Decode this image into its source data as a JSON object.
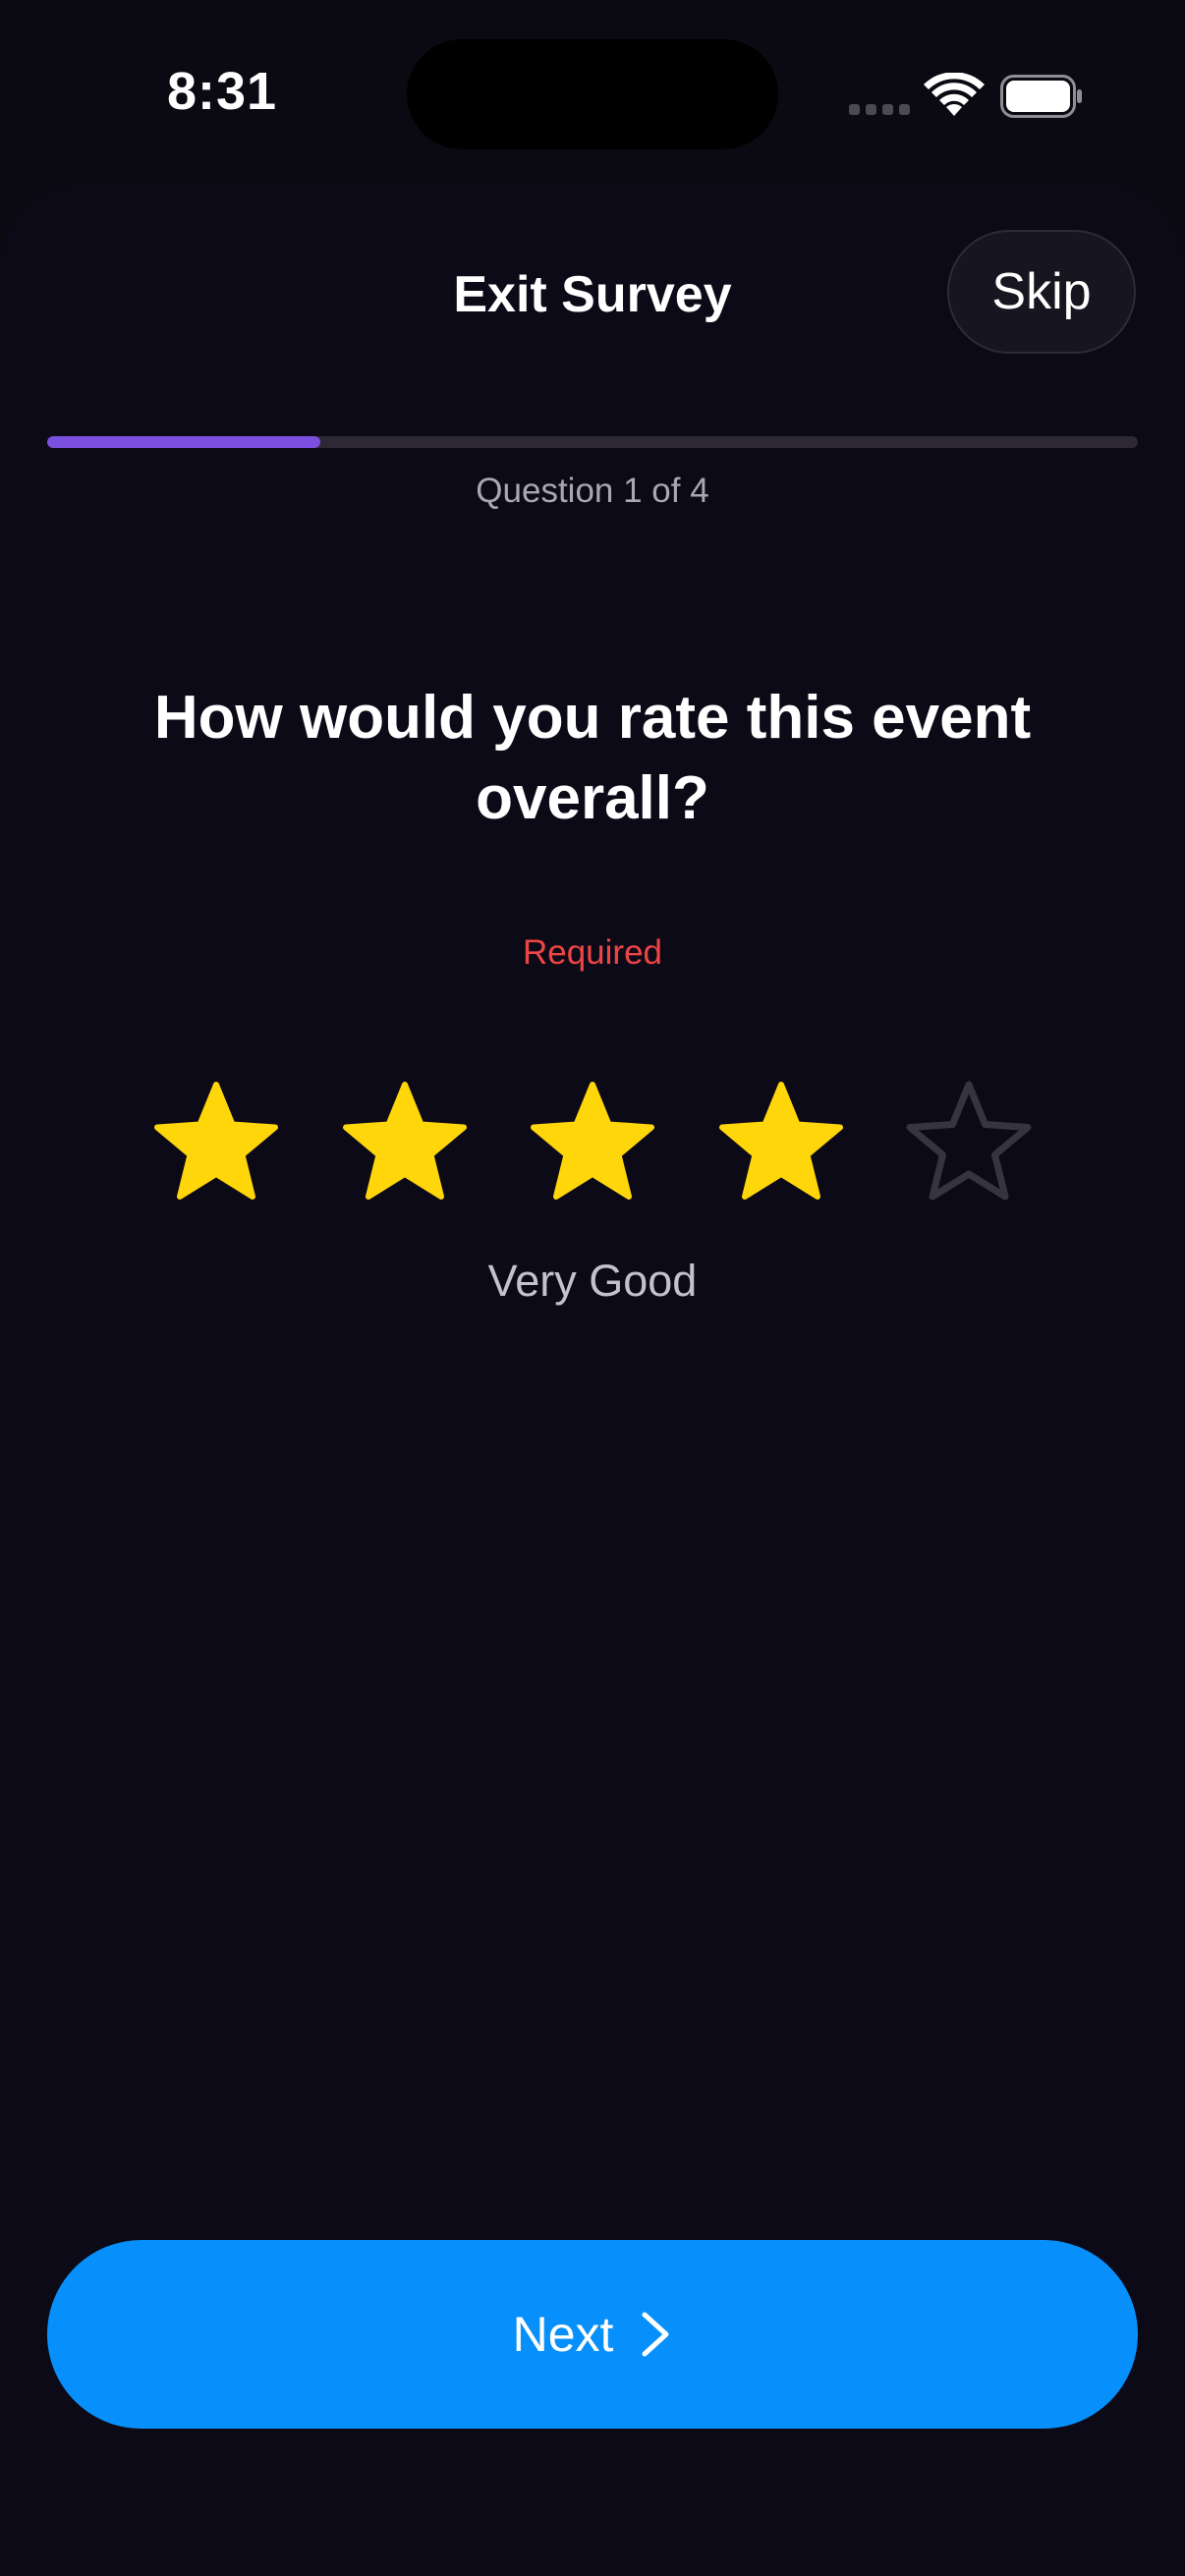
{
  "status_bar": {
    "time": "8:31"
  },
  "survey": {
    "title": "Exit Survey",
    "skip_label": "Skip",
    "progress": {
      "label": "Question 1 of 4",
      "fraction": 0.25,
      "color": "#7b4fe0"
    },
    "question": "How would you rate this event overall?",
    "required_label": "Required",
    "rating": {
      "value": 4,
      "max": 5,
      "label": "Very Good",
      "filled_color": "#ffd60a",
      "empty_color": "#38343f"
    },
    "next_label": "Next",
    "next_icon": "chevron-right-icon",
    "accent_color": "#0790fb"
  }
}
